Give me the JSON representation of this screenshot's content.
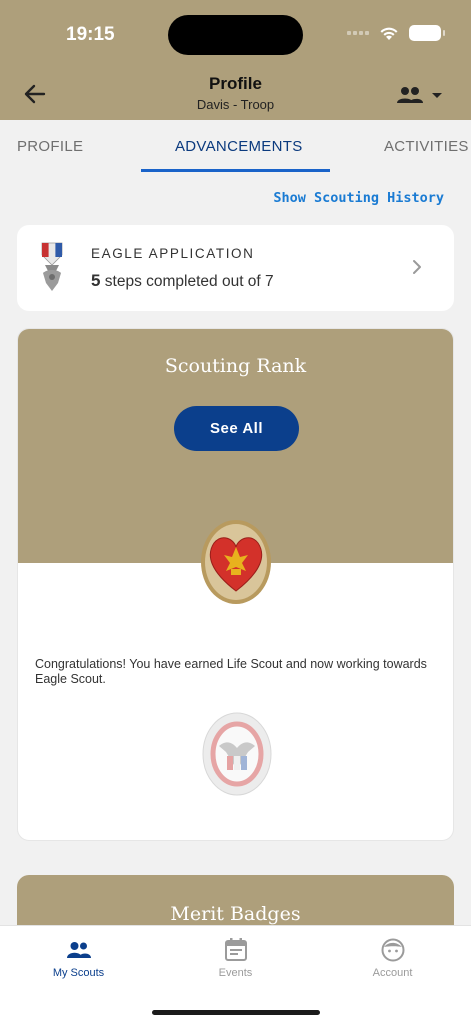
{
  "status_bar": {
    "time": "19:15"
  },
  "header": {
    "title": "Profile",
    "subtitle": "Davis - Troop",
    "back_icon": "arrow-left-icon",
    "switch_icon": "people-icon"
  },
  "tabs": [
    {
      "label": "PROFILE",
      "active": false
    },
    {
      "label": "ADVANCEMENTS",
      "active": true
    },
    {
      "label": "ACTIVITIES",
      "active": false
    }
  ],
  "history_link": "Show Scouting History",
  "eagle_application": {
    "title": "EAGLE APPLICATION",
    "completed": "5",
    "steps_text": "steps completed out of 7"
  },
  "rank_card": {
    "title": "Scouting Rank",
    "button": "See All",
    "message": "Congratulations! You have earned Life Scout and now working towards Eagle Scout."
  },
  "merit_card": {
    "title": "Merit Badges"
  },
  "bottom_nav": [
    {
      "label": "My Scouts",
      "icon": "people-icon",
      "active": true
    },
    {
      "label": "Events",
      "icon": "calendar-icon",
      "active": false
    },
    {
      "label": "Account",
      "icon": "face-icon",
      "active": false
    }
  ],
  "colors": {
    "header_bg": "#ae9f7b",
    "primary": "#0b3f8c",
    "link": "#1a7bd3",
    "tab_indicator": "#1a63c9"
  }
}
